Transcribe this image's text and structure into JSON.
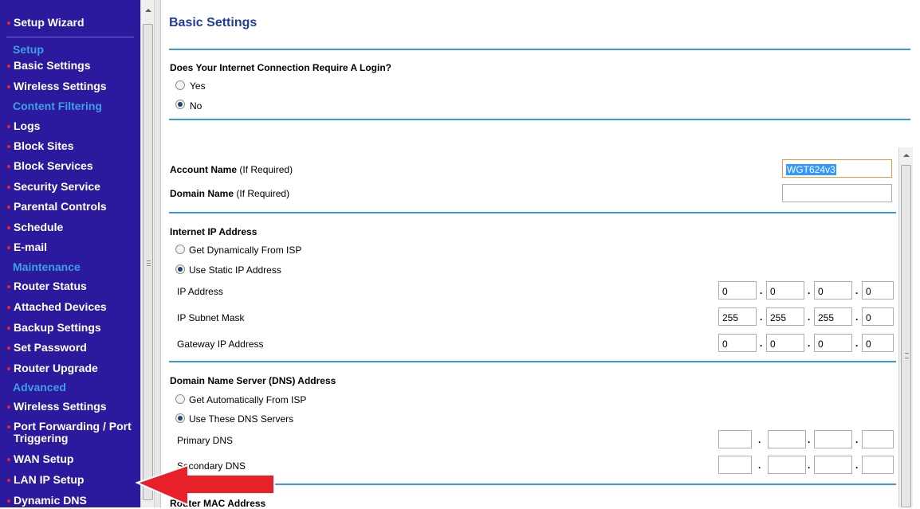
{
  "nav": {
    "items": [
      {
        "type": "link",
        "label": "Setup Wizard"
      },
      {
        "type": "section",
        "label": "Setup"
      },
      {
        "type": "link",
        "label": "Basic Settings"
      },
      {
        "type": "link",
        "label": "Wireless Settings"
      },
      {
        "type": "section",
        "label": "Content Filtering"
      },
      {
        "type": "link",
        "label": "Logs"
      },
      {
        "type": "link",
        "label": "Block Sites"
      },
      {
        "type": "link",
        "label": "Block Services"
      },
      {
        "type": "link",
        "label": "Security Service"
      },
      {
        "type": "link",
        "label": "Parental Controls"
      },
      {
        "type": "link",
        "label": "Schedule"
      },
      {
        "type": "link",
        "label": "E-mail"
      },
      {
        "type": "section",
        "label": "Maintenance"
      },
      {
        "type": "link",
        "label": "Router Status"
      },
      {
        "type": "link",
        "label": "Attached Devices"
      },
      {
        "type": "link",
        "label": "Backup Settings"
      },
      {
        "type": "link",
        "label": "Set Password"
      },
      {
        "type": "link",
        "label": "Router Upgrade"
      },
      {
        "type": "section",
        "label": "Advanced"
      },
      {
        "type": "link",
        "label": "Wireless Settings"
      },
      {
        "type": "link",
        "label": "Port Forwarding / Port Triggering"
      },
      {
        "type": "link",
        "label": "WAN Setup"
      },
      {
        "type": "link",
        "label": "LAN IP Setup"
      },
      {
        "type": "link",
        "label": "Dynamic DNS"
      }
    ]
  },
  "page": {
    "title": "Basic Settings",
    "login_question": "Does Your Internet Connection Require A Login?",
    "login_options": [
      {
        "label": "Yes",
        "selected": false
      },
      {
        "label": "No",
        "selected": true
      }
    ],
    "account_name": {
      "label": "Account Name",
      "hint": "(If Required)",
      "value": "WGT624v3"
    },
    "domain_name": {
      "label": "Domain Name",
      "hint": "(If Required)",
      "value": ""
    },
    "internet_ip": {
      "title": "Internet IP Address",
      "options": [
        {
          "label": "Get Dynamically From ISP",
          "selected": false
        },
        {
          "label": "Use Static IP Address",
          "selected": true
        }
      ],
      "ip_address": {
        "label": "IP Address",
        "octets": [
          "0",
          "0",
          "0",
          "0"
        ]
      },
      "subnet_mask": {
        "label": "IP Subnet Mask",
        "octets": [
          "255",
          "255",
          "255",
          "0"
        ]
      },
      "gateway": {
        "label": "Gateway IP Address",
        "octets": [
          "0",
          "0",
          "0",
          "0"
        ]
      }
    },
    "dns": {
      "title": "Domain Name Server (DNS) Address",
      "options": [
        {
          "label": "Get Automatically From ISP",
          "selected": false
        },
        {
          "label": "Use These DNS Servers",
          "selected": true
        }
      ],
      "primary": {
        "label": "Primary DNS",
        "octets": [
          "",
          "",
          "",
          ""
        ]
      },
      "secondary": {
        "label": "Secondary DNS",
        "octets": [
          "",
          "",
          "",
          ""
        ]
      }
    },
    "router_mac": {
      "title": "Router MAC Address"
    }
  },
  "colors": {
    "nav_bg": "#2b1a9e",
    "section_text": "#3ea0e4",
    "bullet": "#e8262a",
    "title_text": "#1e3d9d",
    "rule": "#3a9bd8",
    "arrow": "#e8202a"
  }
}
